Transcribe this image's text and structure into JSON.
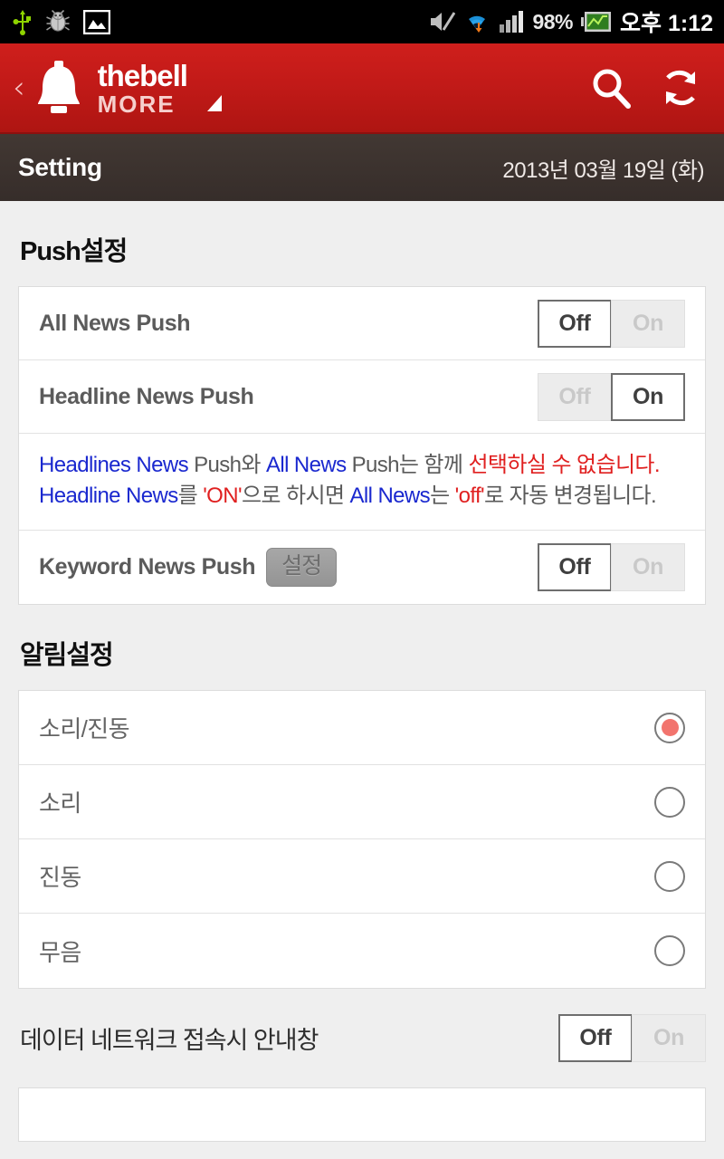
{
  "statusbar": {
    "left_icons": [
      "usb-icon",
      "debug-bug-icon",
      "screenshot-image-icon"
    ],
    "right_icons": [
      "mute-icon",
      "wifi-icon",
      "signal-bars-icon",
      "battery-icon"
    ],
    "battery": "98%",
    "clock": "오후 1:12"
  },
  "appbar": {
    "back_label": "‹",
    "brand_line1": "thebell",
    "brand_line2": "MORE",
    "search_icon": "search-icon",
    "refresh_icon": "refresh-icon"
  },
  "subheader": {
    "title": "Setting",
    "date": "2013년 03월 19일 (화)"
  },
  "push_section": {
    "title": "Push설정",
    "rows": [
      {
        "label": "All News Push",
        "state": "Off",
        "off_label": "Off",
        "on_label": "On"
      },
      {
        "label": "Headline News Push",
        "state": "On",
        "off_label": "Off",
        "on_label": "On"
      },
      {
        "label": "Keyword News Push",
        "button": "설정",
        "state": "Off",
        "off_label": "Off",
        "on_label": "On"
      }
    ],
    "notice": {
      "l1_a": "Headlines News",
      "l1_b": " Push와 ",
      "l1_c": "All News",
      "l1_d": " Push는 함께 ",
      "l1_e": "선택하실 수 없습니다.",
      "l2_a": "Headline News",
      "l2_b": "를 ",
      "l2_c": "'ON'",
      "l2_d": "으로 하시면 ",
      "l2_e": "All News",
      "l2_f": "는 ",
      "l2_g": "'off'",
      "l2_h": "로 자동 변경됩니다."
    }
  },
  "alarm_section": {
    "title": "알림설정",
    "options": [
      {
        "label": "소리/진동",
        "selected": true
      },
      {
        "label": "소리",
        "selected": false
      },
      {
        "label": "진동",
        "selected": false
      },
      {
        "label": "무음",
        "selected": false
      }
    ]
  },
  "data_network_row": {
    "label": "데이터 네트워크 접속시 안내창",
    "state": "Off",
    "off_label": "Off",
    "on_label": "On"
  },
  "colors": {
    "brand_red": "#c21a18",
    "page_bg": "#efefef",
    "radio_accent": "#f2746e",
    "notice_blue": "#1a28cf",
    "notice_red": "#e02020"
  }
}
